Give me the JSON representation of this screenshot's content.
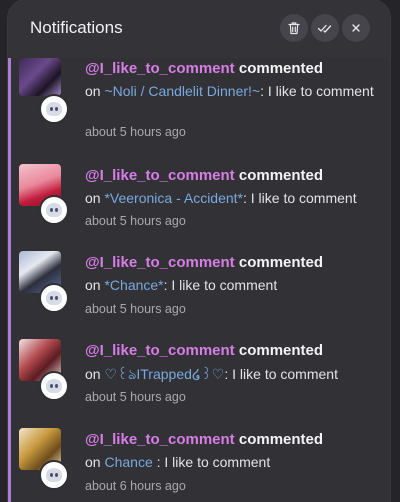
{
  "header": {
    "title": "Notifications",
    "delete_icon": "trash-icon",
    "mark_read_icon": "double-check-icon",
    "close_icon": "close-icon"
  },
  "colors": {
    "panel": "#2f2f34",
    "username": "#d77ee6",
    "work_link": "#7aa9de",
    "unread_accent": "#b07ad8"
  },
  "notifications": [
    {
      "user": "@I_like_to_comment",
      "action": "commented",
      "on": "on",
      "work": "~Noli / Candlelit Dinner!~",
      "comment": ": I like to comment",
      "time": "about 5 hours ago"
    },
    {
      "user": "@I_like_to_comment",
      "action": "commented",
      "on": "on",
      "work": "*Veeronica - Accident*",
      "comment": ": I like to comment",
      "time": "about 5 hours ago"
    },
    {
      "user": "@I_like_to_comment",
      "action": "commented",
      "on": "on",
      "work": "*Chance*",
      "comment": ": I like to comment",
      "time": "about 5 hours ago"
    },
    {
      "user": "@I_like_to_comment",
      "action": "commented",
      "on": "on",
      "work": "♡꒰ঌITrapped໒꒱♡",
      "comment": ": I like to comment",
      "time": "about 5 hours ago"
    },
    {
      "user": "@I_like_to_comment",
      "action": "commented",
      "on": "on",
      "work": "Chance",
      "comment": " : I like to comment",
      "time": "about 6 hours ago"
    }
  ]
}
